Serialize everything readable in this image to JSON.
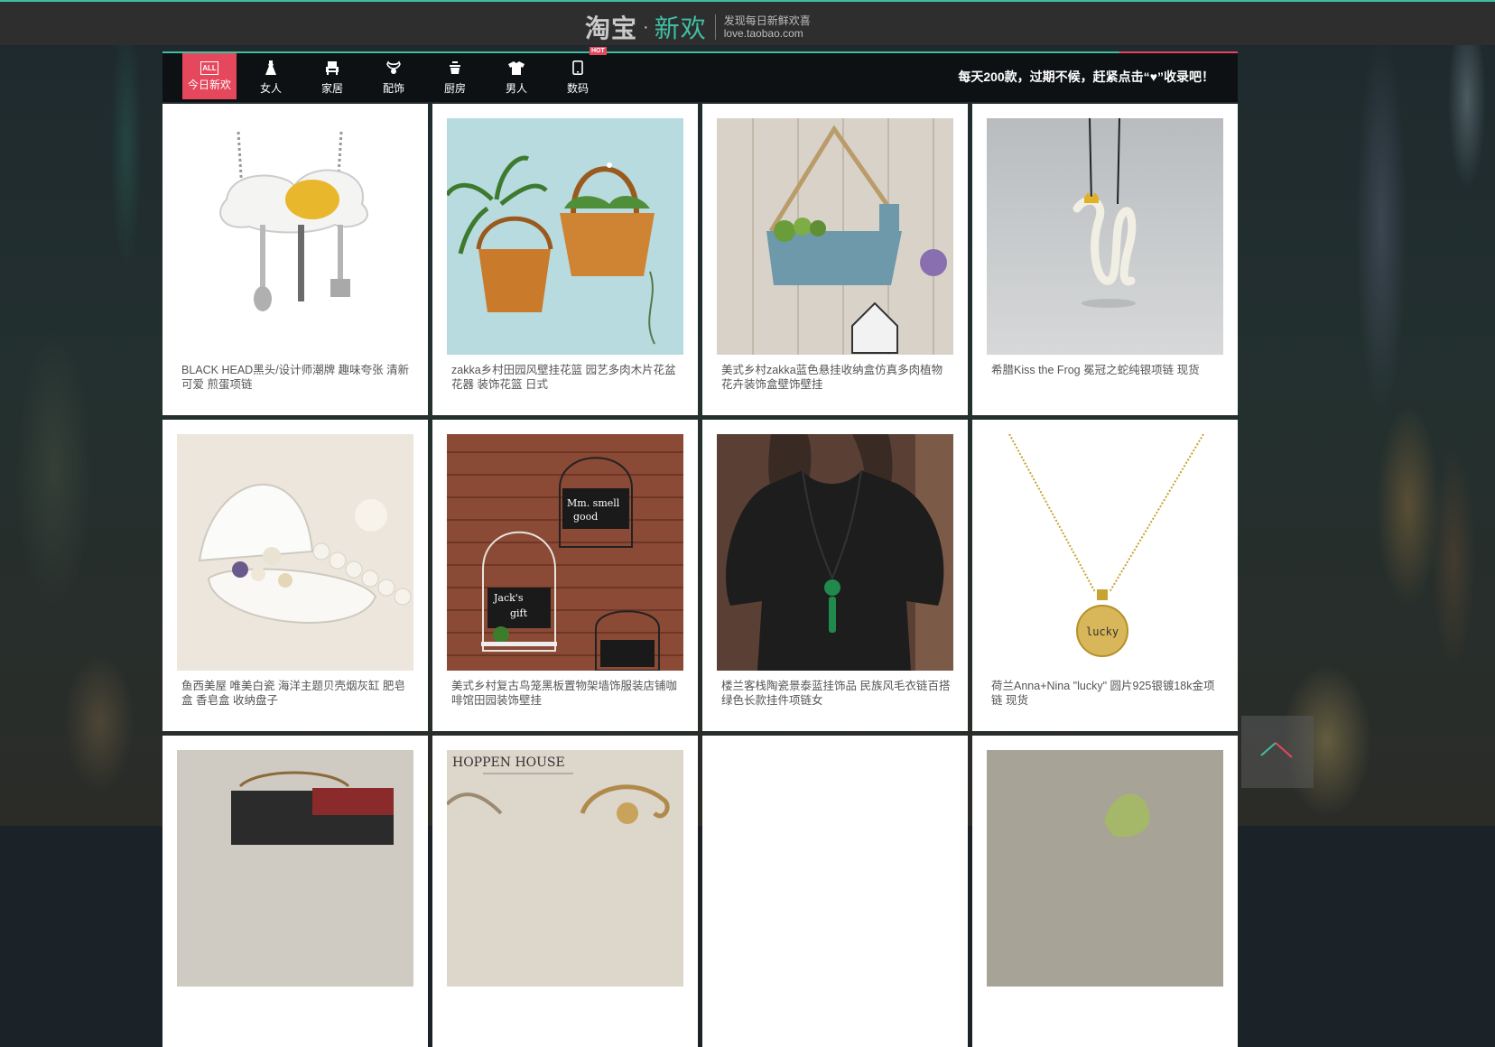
{
  "header": {
    "logo_main": "淘宝",
    "logo_dot": "·",
    "logo_accent": "新欢",
    "tagline": "发现每日新鲜欢喜",
    "domain": "love.taobao.com"
  },
  "nav": {
    "all_badge": "ALL",
    "items": [
      {
        "label": "今日新欢",
        "icon": "all-icon"
      },
      {
        "label": "女人",
        "icon": "dress-icon"
      },
      {
        "label": "家居",
        "icon": "home-icon"
      },
      {
        "label": "配饰",
        "icon": "accessory-icon"
      },
      {
        "label": "厨房",
        "icon": "kitchen-icon"
      },
      {
        "label": "男人",
        "icon": "shirt-icon"
      },
      {
        "label": "数码",
        "icon": "phone-icon"
      }
    ],
    "hot_badge": "HOT",
    "tip_before": "每天200款，过期不候，赶紧点击“",
    "tip_heart": "♥",
    "tip_after": "”收录吧！"
  },
  "products": [
    {
      "title": "BLACK HEAD黑头/设计师潮牌 趣味夸张 清新可爱 煎蛋项链"
    },
    {
      "title": "zakka乡村田园风壁挂花篮 园艺多肉木片花盆花器 装饰花篮 日式"
    },
    {
      "title": "美式乡村zakka蓝色悬挂收纳盒仿真多肉植物花卉装饰盒壁饰壁挂"
    },
    {
      "title": "希腊Kiss the Frog 冕冠之蛇纯银项链 现货"
    },
    {
      "title": "鱼西美屋 唯美白瓷 海洋主题贝壳烟灰缸 肥皂盒 香皂盒 收纳盘子"
    },
    {
      "title": "美式乡村复古鸟笼黑板置物架墙饰服装店铺咖啡馆田园装饰壁挂"
    },
    {
      "title": "楼兰客栈陶瓷景泰蓝挂饰品 民族风毛衣链百搭绿色长款挂件项链女"
    },
    {
      "title": "荷兰Anna+Nina  \"lucky\" 圆片925银镀18k金项链 现货"
    },
    {
      "title": ""
    },
    {
      "title": ""
    },
    {
      "title": ""
    },
    {
      "title": ""
    }
  ],
  "image_text": {
    "jacks_gift": "Jack's gift",
    "mm_smell_good": "Mm. smell good",
    "lucky": "lucky",
    "hoppen_house": "HOPPEN HOUSE"
  },
  "colors": {
    "accent_green": "#3fbf9f",
    "accent_red": "#e5485d"
  }
}
